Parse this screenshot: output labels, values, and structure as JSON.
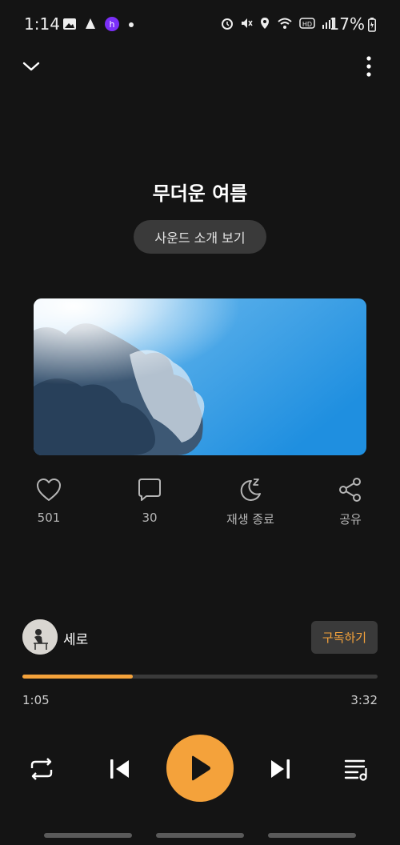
{
  "status_bar": {
    "time": "1:14",
    "battery": "17%",
    "left_icons": [
      "gallery-icon",
      "app-notification-icon",
      "hi-app-icon",
      "dot-icon"
    ],
    "right_icons": [
      "alarm-icon",
      "mute-icon",
      "location-icon",
      "wifi-icon",
      "hd-icon",
      "signal-icon"
    ]
  },
  "header": {
    "collapse_icon": "chevron-down-icon",
    "more_icon": "more-vertical-icon"
  },
  "sound": {
    "title": "무더운 여름",
    "intro_button": "사운드 소개 보기",
    "cover_image": "sky-clouds-sunlight"
  },
  "actions": {
    "like_count": "501",
    "comment_count": "30",
    "sleep_timer_label": "재생 종료",
    "share_label": "공유"
  },
  "creator": {
    "name": "세로",
    "subscribe_label": "구독하기"
  },
  "player": {
    "elapsed": "1:05",
    "total": "3:32",
    "progress_fraction": 0.31
  },
  "colors": {
    "accent": "#f4a23b",
    "background": "#141414",
    "surface": "#3a3a3a"
  }
}
